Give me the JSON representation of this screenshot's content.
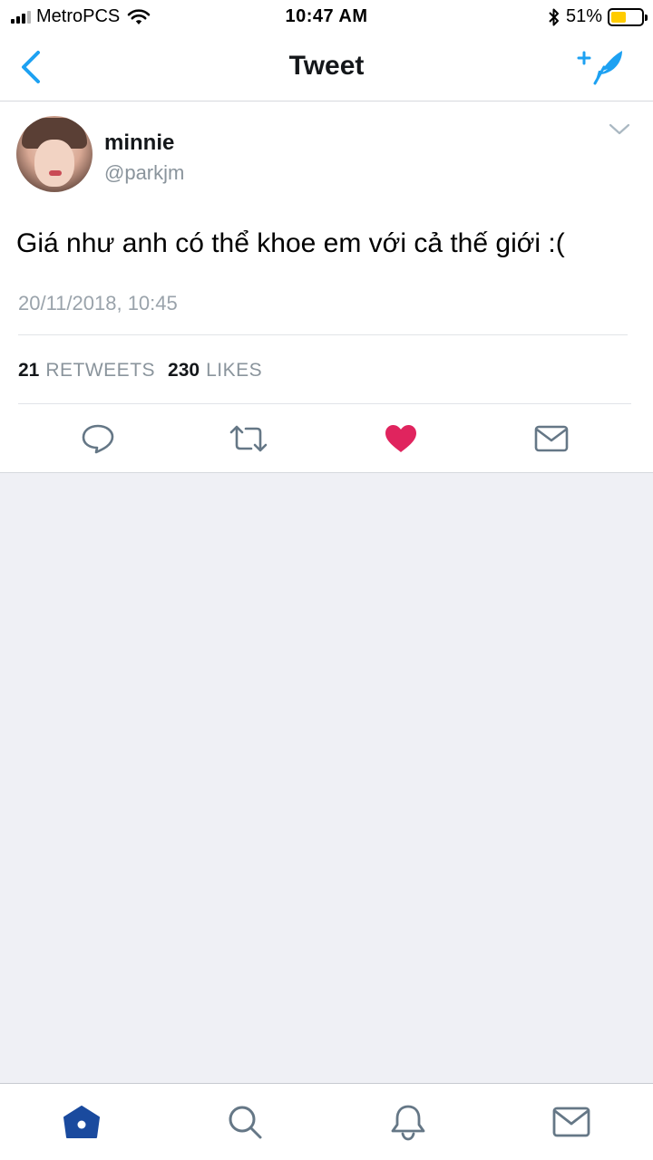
{
  "status_bar": {
    "carrier": "MetroPCS",
    "time": "10:47 AM",
    "battery_percent": "51%",
    "battery_level": 0.51,
    "icons": [
      "signal-icon",
      "wifi-icon",
      "bluetooth-icon",
      "battery-icon"
    ]
  },
  "nav": {
    "title": "Tweet",
    "back_icon": "chevron-left-icon",
    "compose_icon": "compose-feather-icon"
  },
  "tweet": {
    "author": {
      "display_name": "minnie",
      "handle": "@parkjm"
    },
    "text": "Giá như anh có thể khoe em với cả thế giới :(",
    "timestamp": "20/11/2018, 10:45",
    "stats": {
      "retweets_count": "21",
      "retweets_label": "RETWEETS",
      "likes_count": "230",
      "likes_label": "LIKES"
    },
    "actions": [
      "reply-icon",
      "retweet-icon",
      "like-heart-icon",
      "direct-message-icon"
    ],
    "liked": true
  },
  "tab_bar": {
    "tabs": [
      "home-icon",
      "search-icon",
      "notifications-bell-icon",
      "messages-envelope-icon"
    ],
    "active": "home"
  },
  "colors": {
    "accent_blue": "#1da1f2",
    "like_red": "#e0245e",
    "active_tab": "#1a4a9e",
    "icon_gray": "#657786",
    "background": "#eff0f5"
  }
}
